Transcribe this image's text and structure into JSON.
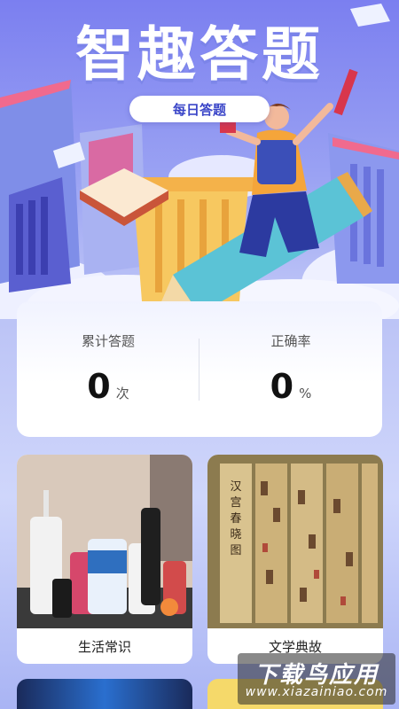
{
  "header": {
    "title": "智趣答题",
    "daily_button": "每日答题"
  },
  "stats": [
    {
      "label": "累计答题",
      "value": "0",
      "unit": "次"
    },
    {
      "label": "正确率",
      "value": "0",
      "unit": "%"
    }
  ],
  "categories": [
    {
      "label": "生活常识",
      "image": "toiletries-photo"
    },
    {
      "label": "文学典故",
      "image": "scroll-painting-photo",
      "image_text": "汉宫春晓图"
    }
  ],
  "watermark": {
    "main": "下载鸟应用",
    "sub": "www.xiazainiao.com"
  },
  "colors": {
    "accent": "#3b46c8",
    "hero_top": "#7b7ff0",
    "card_bg": "#ffffff"
  }
}
